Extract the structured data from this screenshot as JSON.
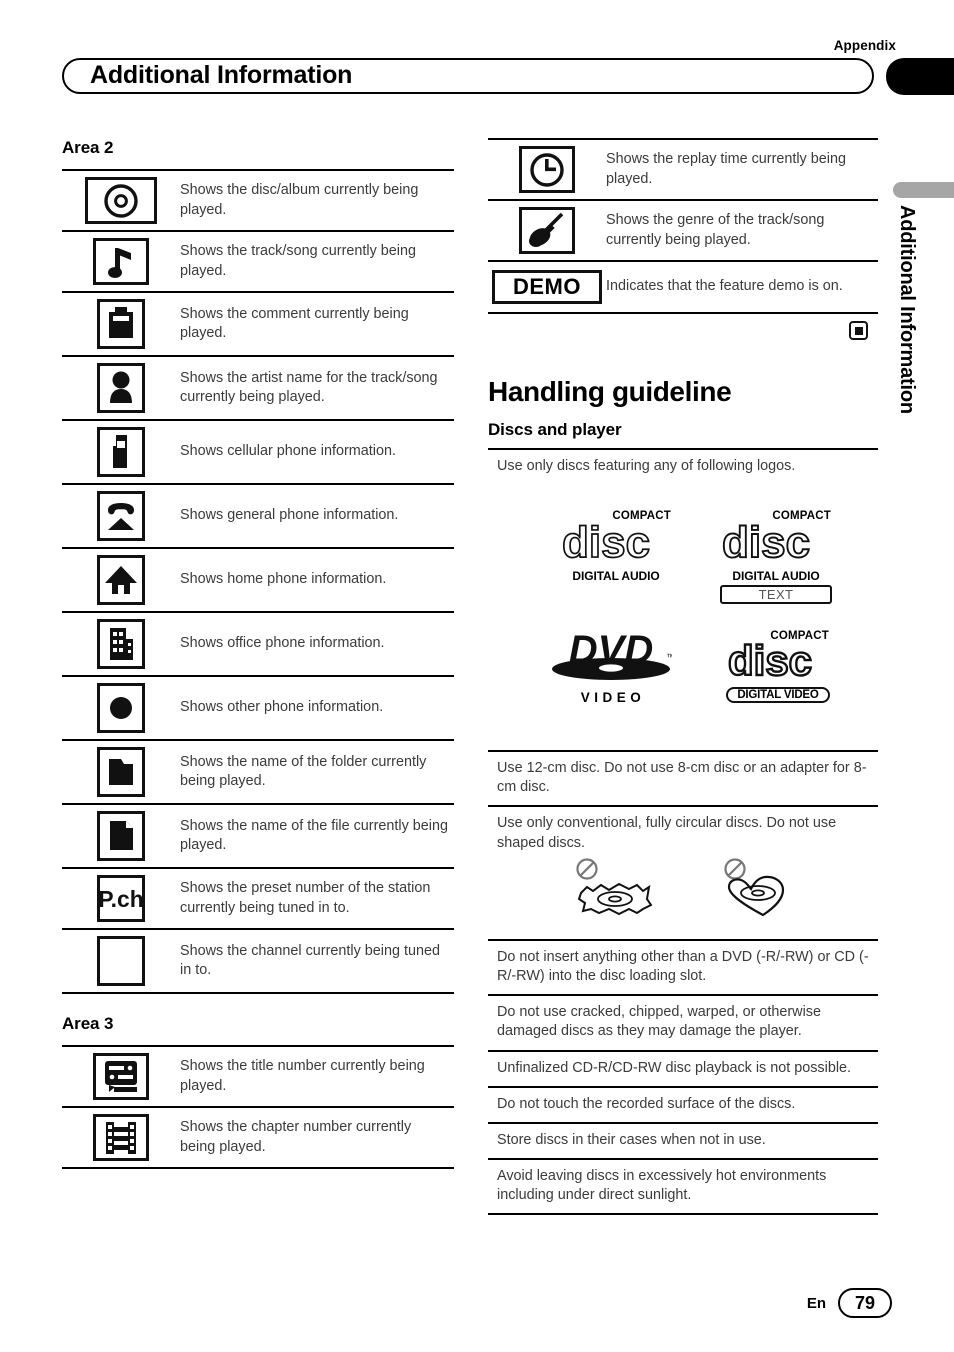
{
  "header": {
    "appendix_label": "Appendix",
    "title": "Additional Information",
    "side_tab_label": "Additional Information"
  },
  "left_column": {
    "area2": {
      "heading": "Area 2",
      "rows": [
        {
          "icon": "disc-icon",
          "text": "Shows the disc/album currently being played."
        },
        {
          "icon": "music-note-icon",
          "text": "Shows the track/song currently being played."
        },
        {
          "icon": "comment-clip-icon",
          "text": "Shows the comment currently being played."
        },
        {
          "icon": "person-icon",
          "text": "Shows the artist name for  the track/song currently being played."
        },
        {
          "icon": "cellphone-icon",
          "text": "Shows cellular phone information."
        },
        {
          "icon": "handset-icon",
          "text": "Shows general phone information."
        },
        {
          "icon": "home-icon",
          "text": "Shows home phone information."
        },
        {
          "icon": "office-building-icon",
          "text": "Shows office phone information."
        },
        {
          "icon": "filled-circle-icon",
          "text": "Shows other phone information."
        },
        {
          "icon": "folder-icon",
          "text": "Shows the name of the folder currently being played."
        },
        {
          "icon": "file-icon",
          "text": "Shows the name of the file currently being played."
        },
        {
          "icon": "preset-channel-icon",
          "text": "Shows the preset number of the station currently being tuned in to."
        },
        {
          "icon": "empty-box-icon",
          "text": "Shows the channel currently being tuned in to."
        }
      ]
    },
    "area3": {
      "heading": "Area 3",
      "rows": [
        {
          "icon": "title-number-icon",
          "text": "Shows the title number currently being played."
        },
        {
          "icon": "chapter-film-icon",
          "text": "Shows the chapter number currently being played."
        }
      ]
    }
  },
  "right_column": {
    "top_rows": [
      {
        "icon": "clock-icon",
        "text": "Shows the replay time currently being played."
      },
      {
        "icon": "guitar-icon",
        "text": "Shows the genre of the track/song currently being played."
      },
      {
        "icon": "demo-badge",
        "label": "DEMO",
        "text": "Indicates that the feature demo is on."
      }
    ],
    "handling": {
      "title": "Handling guideline",
      "subtitle": "Discs and player",
      "intro": "Use only discs featuring any of following logos.",
      "logos": [
        {
          "name": "compact-disc-digital-audio-logo",
          "top": "COMPACT",
          "word": "disc",
          "bottom": "DIGITAL AUDIO"
        },
        {
          "name": "compact-disc-digital-audio-text-logo",
          "top": "COMPACT",
          "word": "disc",
          "bottom": "DIGITAL AUDIO",
          "extra": "TEXT"
        },
        {
          "name": "dvd-video-logo",
          "word": "DVD",
          "bottom": "VIDEO",
          "tm": "™"
        },
        {
          "name": "compact-disc-digital-video-logo",
          "top": "COMPACT",
          "word": "disc",
          "bottom": "DIGITAL VIDEO"
        }
      ],
      "rules": [
        "Use 12-cm disc. Do not use 8-cm disc or an adapter for 8-cm disc.",
        "Use only conventional, fully circular discs. Do not use shaped discs.",
        "Do not insert anything other than a DVD (-R/-RW) or CD (-R/-RW) into the disc loading slot.",
        "Do not use cracked, chipped, warped, or otherwise damaged discs as they may damage the player.",
        "Unfinalized CD-R/CD-RW disc playback is not possible.",
        "Do not touch the recorded surface of the discs.",
        "Store discs in their cases when not in use.",
        "Avoid leaving discs in excessively hot environments including under direct sunlight."
      ]
    }
  },
  "footer": {
    "language": "En",
    "page_number": "79"
  }
}
